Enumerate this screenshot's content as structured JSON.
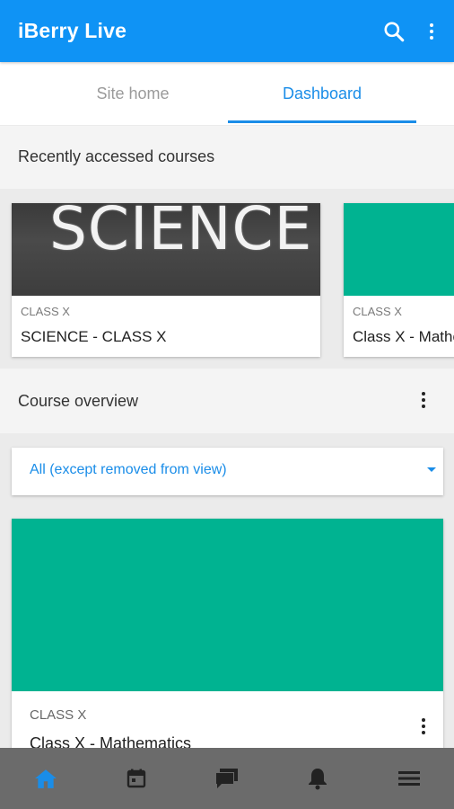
{
  "app": {
    "title": "iBerry Live",
    "accent_color": "#0f93f5",
    "icons": [
      "search-icon",
      "more-vert-icon"
    ]
  },
  "tabs": [
    {
      "label": "Site home",
      "active": false
    },
    {
      "label": "Dashboard",
      "active": true
    }
  ],
  "recent": {
    "header": "Recently accessed courses",
    "courses": [
      {
        "image_text": "SCIENCE",
        "category": "CLASS X",
        "name": "SCIENCE - CLASS X"
      },
      {
        "image_color": "#00b391",
        "category": "CLASS X",
        "name": "Class X - Mathematics"
      }
    ]
  },
  "overview": {
    "header": "Course overview",
    "filter_value": "All (except removed from view)",
    "courses": [
      {
        "image_color": "#00b391",
        "category": "CLASS X",
        "name": "Class X - Mathematics"
      }
    ]
  },
  "bottom_nav": {
    "items": [
      {
        "icon": "home-icon",
        "active": true,
        "color": "#1a8de8"
      },
      {
        "icon": "calendar-icon",
        "active": false
      },
      {
        "icon": "messages-icon",
        "active": false
      },
      {
        "icon": "bell-icon",
        "active": false
      },
      {
        "icon": "menu-icon",
        "active": false
      }
    ]
  }
}
